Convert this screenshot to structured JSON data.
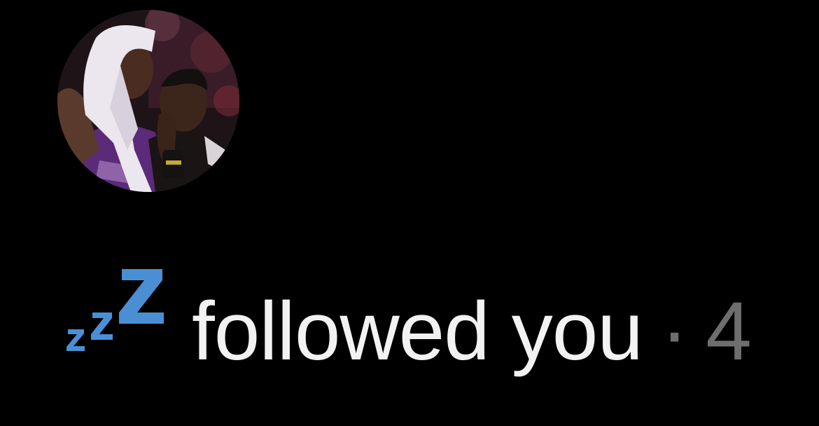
{
  "notification": {
    "status_emoji": "zzz-icon",
    "action_text": "followed you",
    "separator": "·",
    "timestamp": "4",
    "colors": {
      "background": "#000000",
      "text": "#f2f2f2",
      "muted": "#6e6e6e",
      "emoji_blue": "#4a8fd4"
    }
  }
}
